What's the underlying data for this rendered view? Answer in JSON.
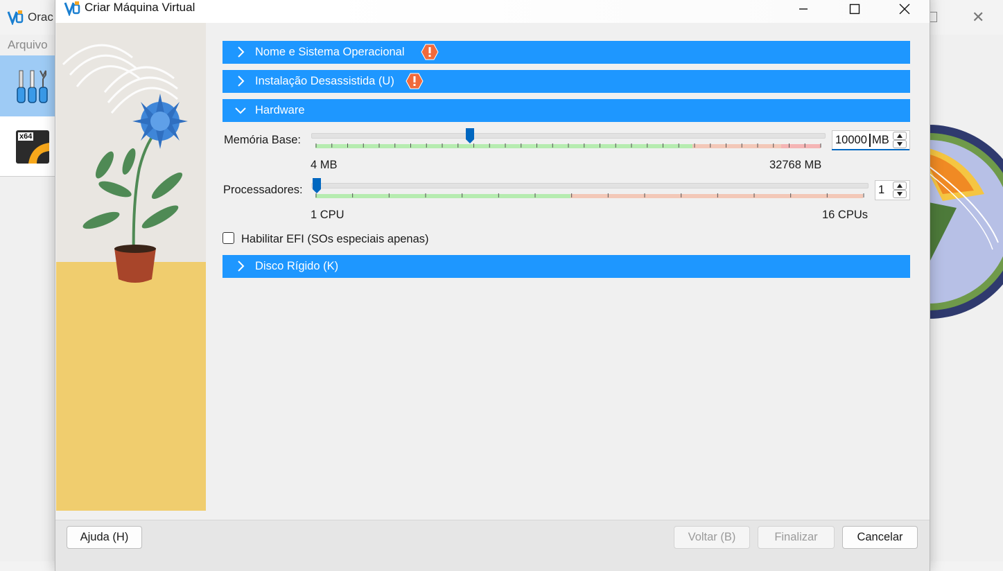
{
  "background_window": {
    "title": "Orac",
    "menu_first": "Arquivo",
    "vm_badge": "x64"
  },
  "dialog": {
    "title": "Criar Máquina Virtual",
    "sections": {
      "name_os": {
        "label": "Nome e Sistema Operacional",
        "expanded": false,
        "warning": true
      },
      "unattended": {
        "label": "Instalação Desassistida (U)",
        "expanded": false,
        "warning": true
      },
      "hardware": {
        "label": "Hardware",
        "expanded": true,
        "warning": false
      },
      "disk": {
        "label": "Disco Rígido (K)",
        "expanded": false,
        "warning": false
      }
    },
    "hardware": {
      "memory": {
        "label": "Memória Base:",
        "value": "10000",
        "unit": "MB",
        "min_label": "4 MB",
        "max_label": "32768 MB",
        "min": 4,
        "max": 32768,
        "current": 10000
      },
      "processors": {
        "label": "Processadores:",
        "value": "1",
        "min_label": "1 CPU",
        "max_label": "16 CPUs",
        "min": 1,
        "max": 16,
        "current": 1
      },
      "efi": {
        "label": "Habilitar EFI (SOs especiais apenas)",
        "checked": false
      }
    },
    "buttons": {
      "help": "Ajuda (H)",
      "back": "Voltar (B)",
      "finish": "Finalizar",
      "cancel": "Cancelar"
    }
  },
  "colors": {
    "section_header": "#1e97ff",
    "slider_handle": "#0067c0",
    "zone_ok": "#b6ecb0",
    "zone_warn": "#f3c8b8",
    "zone_bad": "#f5b5b5"
  }
}
